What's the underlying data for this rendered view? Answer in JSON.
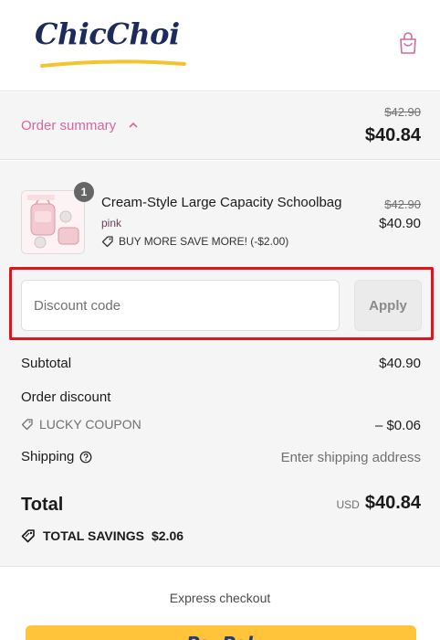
{
  "brand": {
    "name": "ChicChoi"
  },
  "summary": {
    "label": "Order summary",
    "original_total": "$42.90",
    "total": "$40.84"
  },
  "item": {
    "quantity": "1",
    "name": "Cream-Style Large Capacity Schoolbag",
    "variant": "pink",
    "discount": "BUY MORE SAVE MORE! (-$2.00)",
    "original_price": "$42.90",
    "price": "$40.90"
  },
  "discount_form": {
    "placeholder": "Discount code",
    "apply_label": "Apply"
  },
  "totals": {
    "subtotal_label": "Subtotal",
    "subtotal_value": "$40.90",
    "order_discount_label": "Order discount",
    "coupon_label": "LUCKY COUPON",
    "coupon_value": "– $0.06",
    "shipping_label": "Shipping",
    "shipping_value": "Enter shipping address",
    "total_label": "Total",
    "currency": "USD",
    "total_value": "$40.84",
    "savings_label": "TOTAL SAVINGS",
    "savings_value": "$2.06"
  },
  "checkout": {
    "express_label": "Express checkout",
    "paypal_label": "PayPal"
  },
  "colors": {
    "accent_pink": "#d6679e",
    "logo_navy": "#1d2a5c",
    "highlight_red": "#e0141a",
    "paypal_yellow": "#ffc439"
  }
}
